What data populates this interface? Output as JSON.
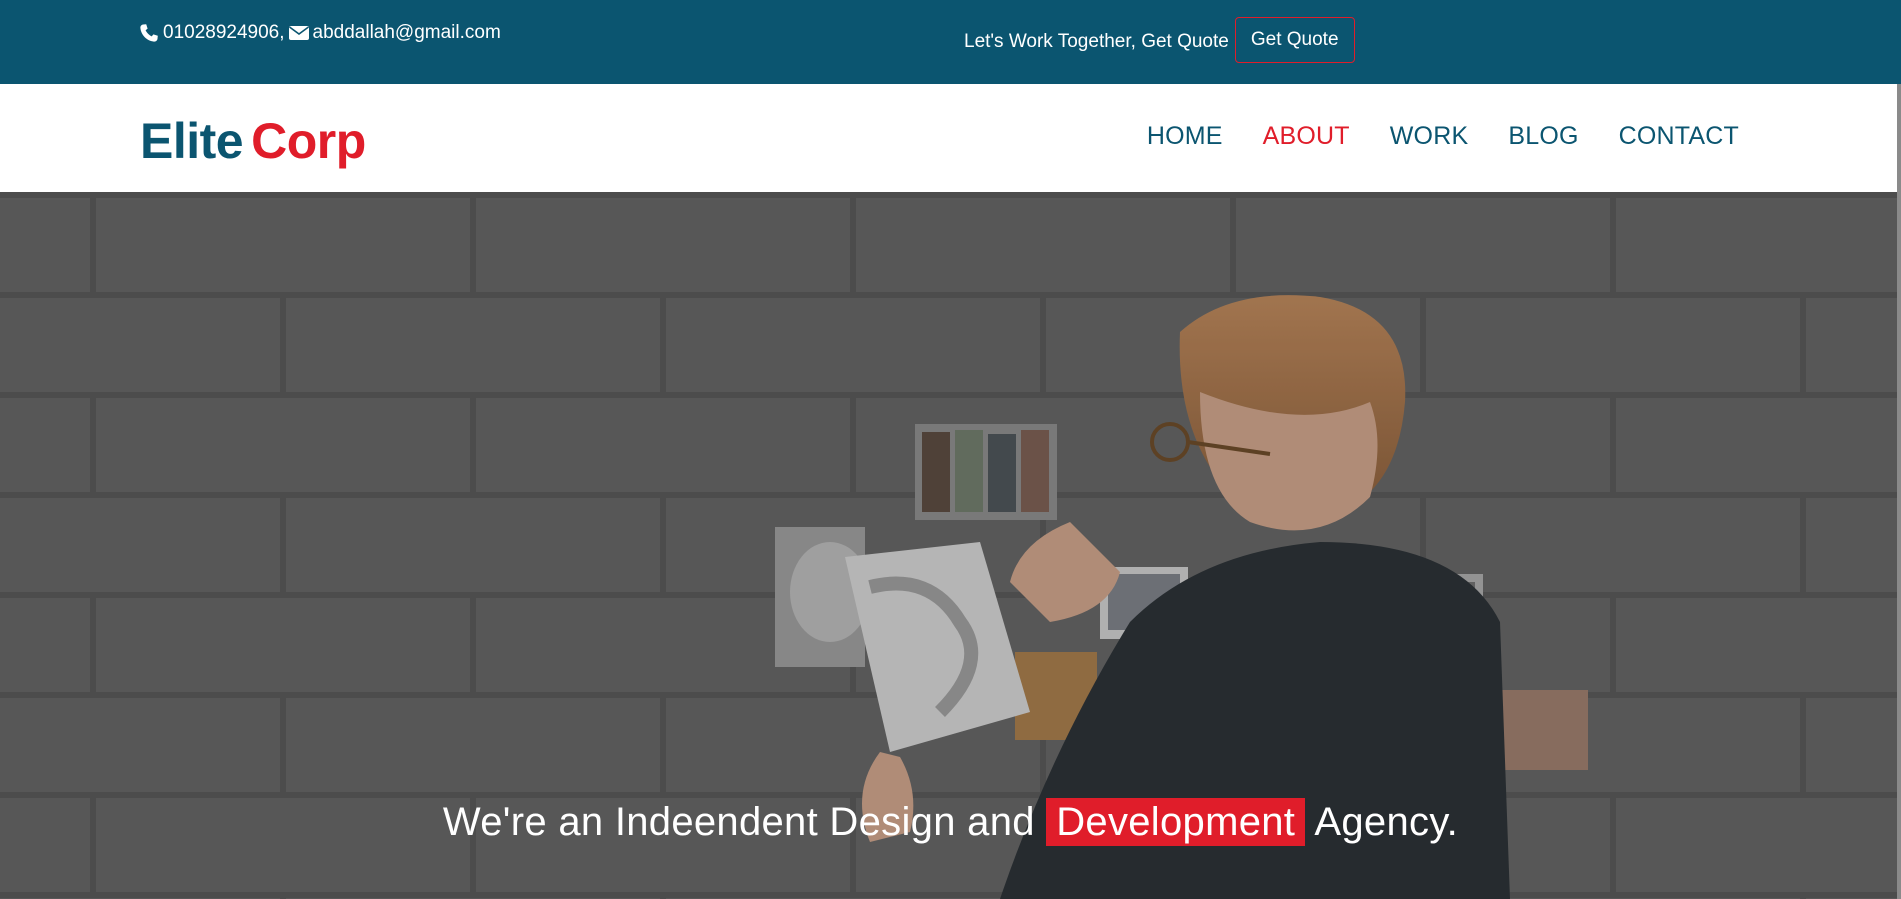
{
  "topbar": {
    "phone": "01028924906,",
    "email": "abddallah@gmail.com",
    "quote_text": "Let's Work Together, Get Quote",
    "quote_button": "Get Quote"
  },
  "brand": {
    "part1": "Elite",
    "part2": "Corp"
  },
  "nav": {
    "items": [
      {
        "label": "HOME"
      },
      {
        "label": "ABOUT"
      },
      {
        "label": "WORK"
      },
      {
        "label": "BLOG"
      },
      {
        "label": "CONTACT"
      }
    ],
    "active": "ABOUT"
  },
  "hero": {
    "text_before": "We're an Indeendent Design and ",
    "highlight": "Development",
    "text_after": " Agency."
  },
  "colors": {
    "primary": "#0b5570",
    "accent": "#e01d2a"
  },
  "icons": {
    "phone": "phone-icon",
    "email": "envelope-icon"
  }
}
